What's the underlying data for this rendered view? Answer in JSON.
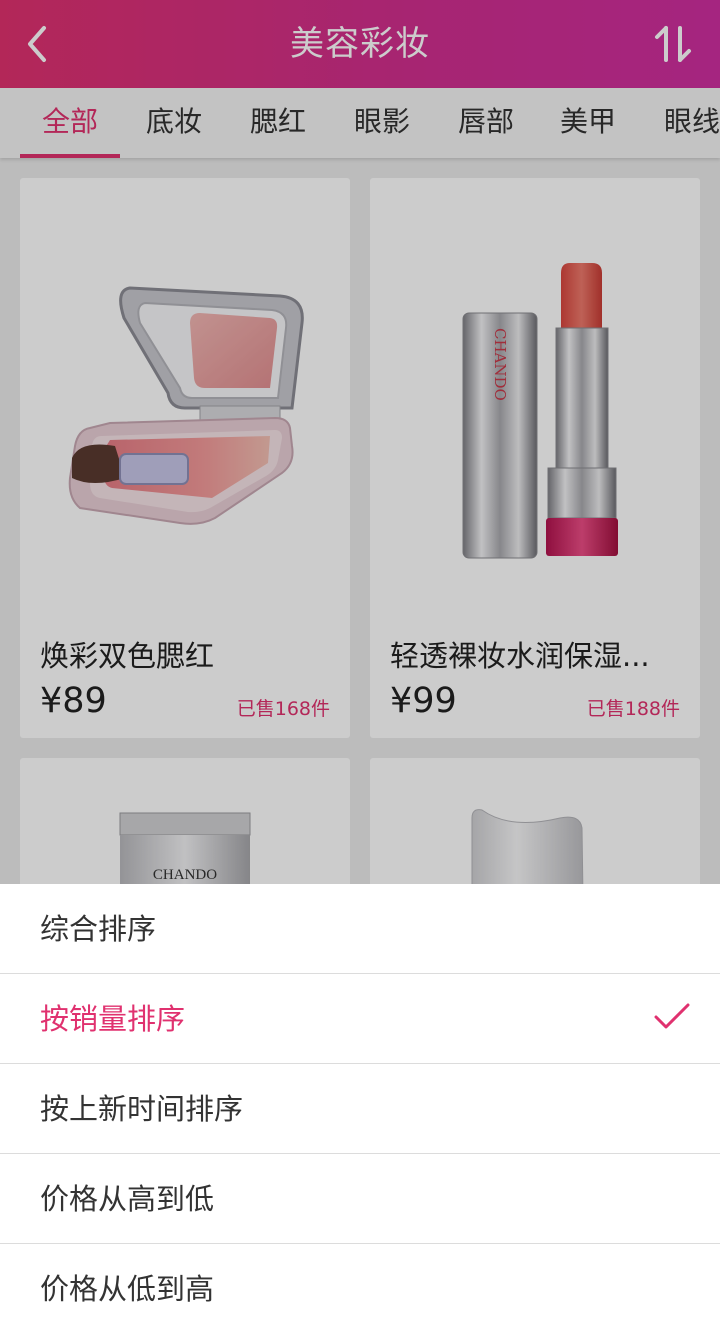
{
  "header": {
    "title": "美容彩妆"
  },
  "tabs": [
    {
      "label": "全部",
      "active": true
    },
    {
      "label": "底妆"
    },
    {
      "label": "腮红"
    },
    {
      "label": "眼影"
    },
    {
      "label": "唇部"
    },
    {
      "label": "美甲"
    },
    {
      "label": "眼线"
    }
  ],
  "products": [
    {
      "name": "焕彩双色腮红",
      "price": "¥89",
      "sold": "已售168件",
      "image": "blush-compact"
    },
    {
      "name": "轻透裸妆水润保湿...",
      "price": "¥99",
      "sold": "已售188件",
      "image": "lipstick-chando"
    },
    {
      "brand": "CHANDO",
      "image": "cream-tube"
    },
    {
      "image": "white-bottle"
    }
  ],
  "sort_sheet": {
    "options": [
      {
        "label": "综合排序"
      },
      {
        "label": "按销量排序",
        "selected": true
      },
      {
        "label": "按上新时间排序"
      },
      {
        "label": "价格从高到低"
      },
      {
        "label": "价格从低到高"
      }
    ]
  },
  "colors": {
    "accent": "#e0316f",
    "header_end": "#cf2fa0"
  }
}
